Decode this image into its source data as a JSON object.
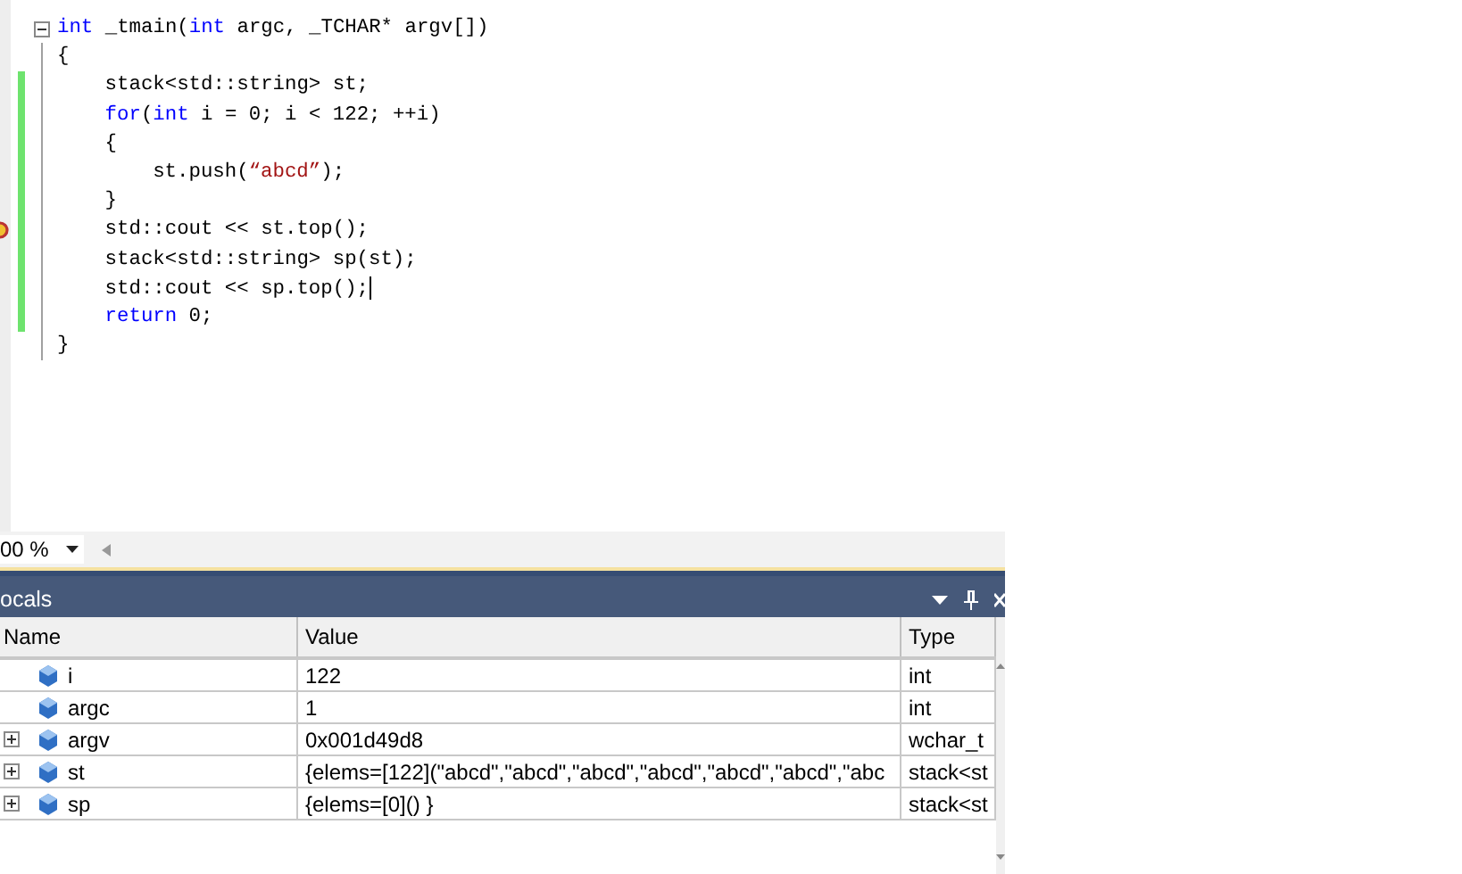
{
  "editor": {
    "lines": [
      {
        "fold": true,
        "changed": false,
        "breakpoint": false,
        "caret": false,
        "segments": [
          {
            "kind": "keyword",
            "text": "int"
          },
          {
            "kind": "plain",
            "text": " _tmain("
          },
          {
            "kind": "keyword",
            "text": "int"
          },
          {
            "kind": "plain",
            "text": " argc, _TCHAR* argv[])"
          }
        ]
      },
      {
        "fold": false,
        "changed": false,
        "breakpoint": false,
        "caret": false,
        "segments": [
          {
            "kind": "plain",
            "text": "{"
          }
        ],
        "children": [
          {
            "fold": false,
            "changed": true,
            "breakpoint": false,
            "caret": false,
            "segments": [
              {
                "kind": "plain",
                "text": "stack<std::string> st;"
              }
            ]
          },
          {
            "fold": false,
            "changed": true,
            "breakpoint": false,
            "caret": false,
            "segments": [
              {
                "kind": "keyword",
                "text": "for"
              },
              {
                "kind": "plain",
                "text": "("
              },
              {
                "kind": "keyword",
                "text": "int"
              },
              {
                "kind": "plain",
                "text": " i = 0; i < 122; ++i)"
              }
            ]
          },
          {
            "fold": false,
            "changed": true,
            "breakpoint": false,
            "caret": false,
            "segments": [
              {
                "kind": "plain",
                "text": "{"
              }
            ],
            "children": [
              {
                "fold": false,
                "changed": true,
                "breakpoint": false,
                "caret": false,
                "segments": [
                  {
                    "kind": "plain",
                    "text": "st.push("
                  },
                  {
                    "kind": "string",
                    "text": "“abcd”"
                  },
                  {
                    "kind": "plain",
                    "text": ");"
                  }
                ]
              }
            ]
          },
          {
            "fold": false,
            "changed": true,
            "breakpoint": false,
            "caret": false,
            "segments": [
              {
                "kind": "plain",
                "text": "}"
              }
            ]
          },
          {
            "fold": false,
            "changed": true,
            "breakpoint": true,
            "caret": false,
            "segments": [
              {
                "kind": "plain",
                "text": "std::cout << st.top();"
              }
            ]
          },
          {
            "fold": false,
            "changed": true,
            "breakpoint": false,
            "caret": false,
            "segments": [
              {
                "kind": "plain",
                "text": "stack<std::string> sp(st);"
              }
            ]
          },
          {
            "fold": false,
            "changed": true,
            "breakpoint": false,
            "caret": true,
            "segments": [
              {
                "kind": "plain",
                "text": "std::cout << sp.top();"
              }
            ]
          },
          {
            "fold": false,
            "changed": true,
            "breakpoint": false,
            "caret": false,
            "segments": [
              {
                "kind": "keyword",
                "text": "return"
              },
              {
                "kind": "plain",
                "text": " 0;"
              }
            ]
          }
        ]
      },
      {
        "fold": false,
        "changed": false,
        "breakpoint": false,
        "caret": false,
        "segments": [
          {
            "kind": "plain",
            "text": "}"
          }
        ]
      }
    ]
  },
  "zoom": {
    "value": "00 %"
  },
  "locals": {
    "title": "ocals",
    "columns": [
      "Name",
      "Value",
      "Type"
    ],
    "rows": [
      {
        "expandable": false,
        "name": "i",
        "value": "122",
        "type": "int"
      },
      {
        "expandable": false,
        "name": "argc",
        "value": "1",
        "type": "int"
      },
      {
        "expandable": true,
        "name": "argv",
        "value": "0x001d49d8",
        "type": "wchar_t"
      },
      {
        "expandable": true,
        "name": "st",
        "value": "{elems=[122](\"abcd\",\"abcd\",\"abcd\",\"abcd\",\"abcd\",\"abcd\",\"abc",
        "type": "stack<st"
      },
      {
        "expandable": true,
        "name": "sp",
        "value": "{elems=[0]() }",
        "type": "stack<st"
      }
    ]
  }
}
